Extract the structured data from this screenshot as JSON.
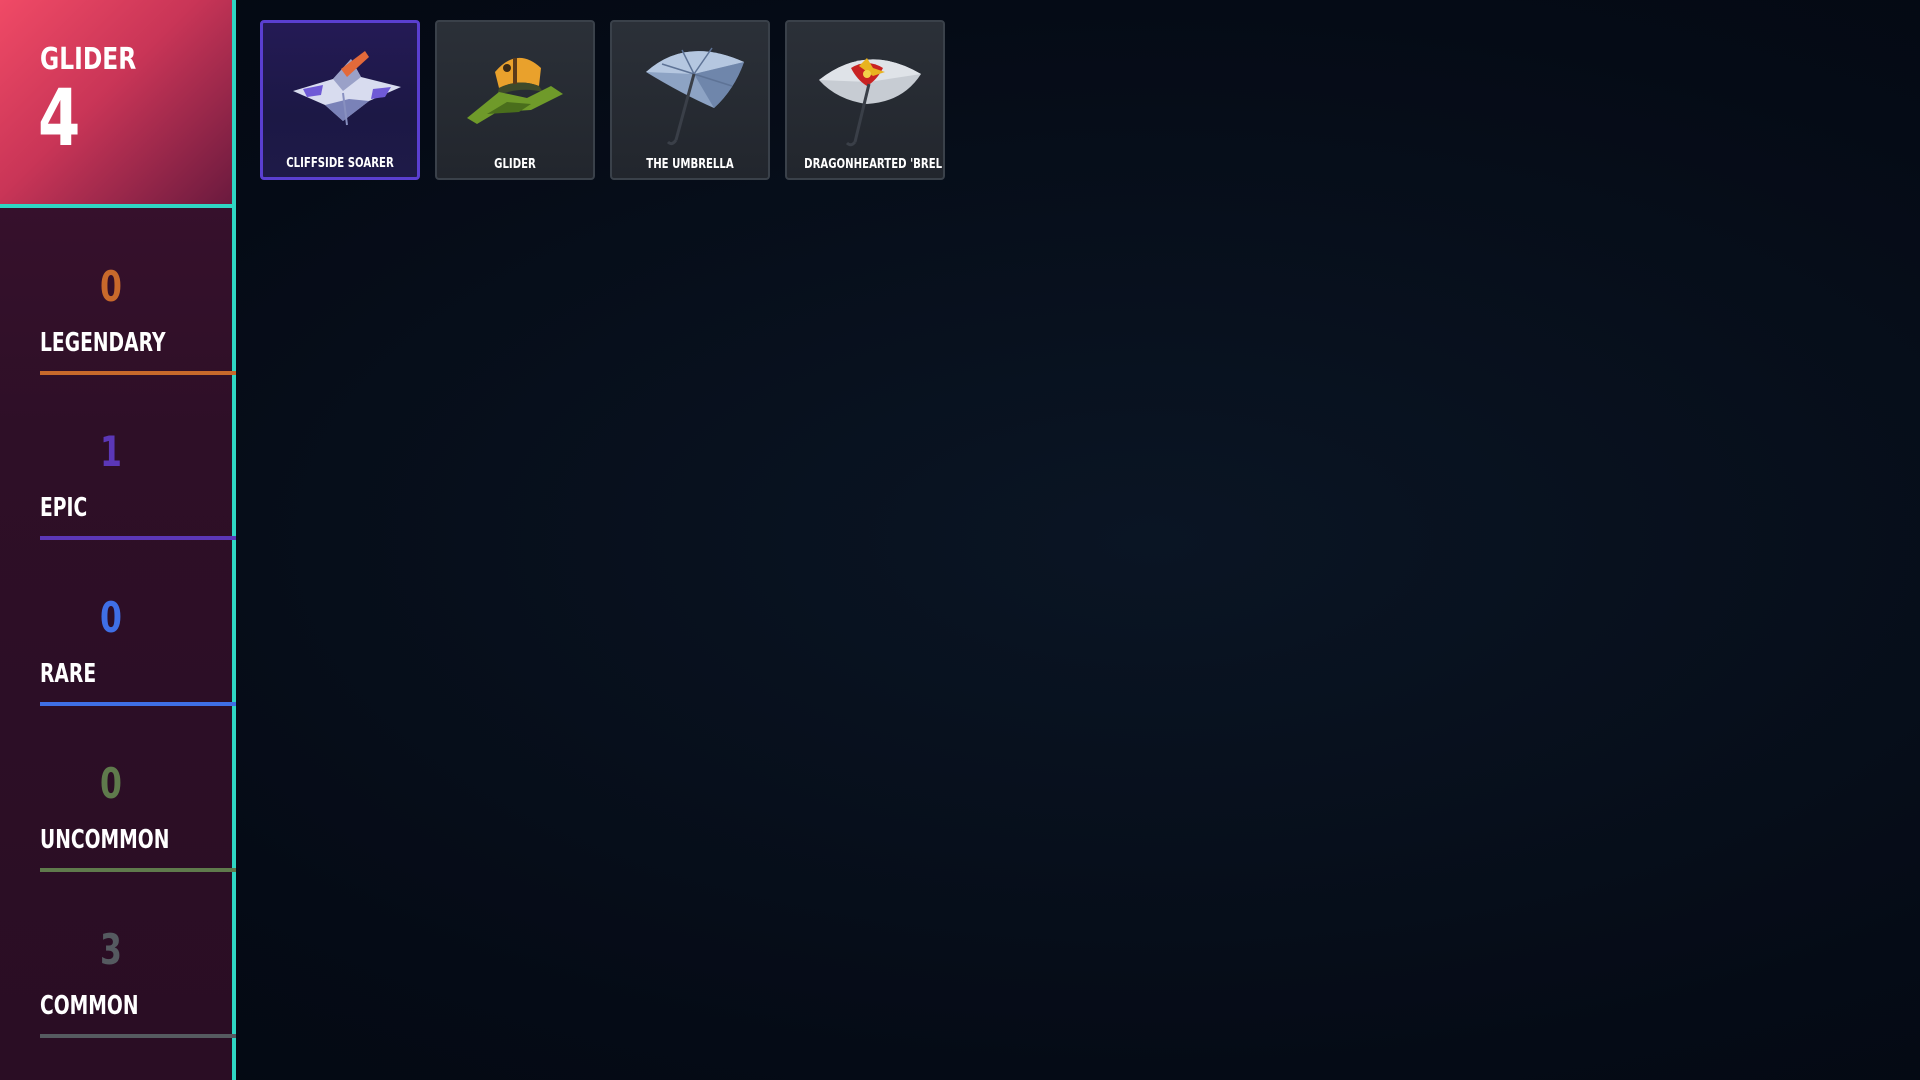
{
  "summary": {
    "title": "GLIDER",
    "count": "4"
  },
  "rarities": [
    {
      "count": "0",
      "label": "LEGENDARY",
      "color": "#c8692b"
    },
    {
      "count": "1",
      "label": "EPIC",
      "color": "#5b37b7"
    },
    {
      "count": "0",
      "label": "RARE",
      "color": "#3f6fe6"
    },
    {
      "count": "0",
      "label": "UNCOMMON",
      "color": "#5f7a4c"
    },
    {
      "count": "3",
      "label": "COMMON",
      "color": "#555a60"
    }
  ],
  "items": [
    {
      "name": "CLIFFSIDE SOARER",
      "icon": "cliffside-soarer-glider-icon",
      "selected": true
    },
    {
      "name": "GLIDER",
      "icon": "glider-icon",
      "selected": false
    },
    {
      "name": "THE UMBRELLA",
      "icon": "umbrella-icon",
      "selected": false
    },
    {
      "name": "DRAGONHEARTED 'BRELLA",
      "icon": "dragonhearted-umbrella-icon",
      "selected": false
    }
  ],
  "colors": {
    "accent_teal": "#2fd6c3",
    "summary_red": "#f04a66",
    "background": "#050c17"
  }
}
